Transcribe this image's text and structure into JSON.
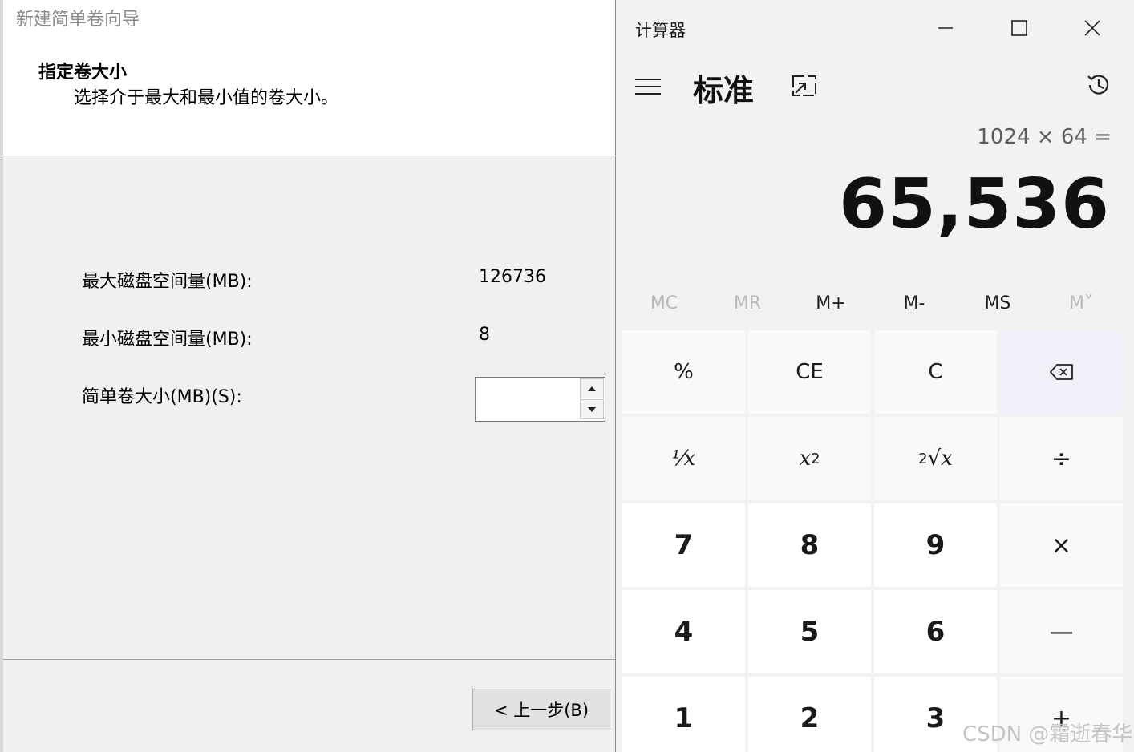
{
  "wizard": {
    "title": "新建简单卷向导",
    "heading": "指定卷大小",
    "subheading": "选择介于最大和最小值的卷大小。",
    "max_label": "最大磁盘空间量(MB):",
    "max_value": "126736",
    "min_label": "最小磁盘空间量(MB):",
    "min_value": "8",
    "size_label": "简单卷大小(MB)(S):",
    "size_value": "",
    "back_button": "< 上一步(B)"
  },
  "calculator": {
    "title": "计算器",
    "mode": "标准",
    "expression": "1024 × 64 =",
    "result": "65,536",
    "memory": [
      "MC",
      "MR",
      "M+",
      "M-",
      "MS",
      "M˅"
    ],
    "keys": {
      "percent": "%",
      "ce": "CE",
      "c": "C",
      "reciprocal": "⅟x",
      "square": "x",
      "square_sup": "2",
      "sqrt": "√x",
      "sqrt_sup": "2",
      "divide": "÷",
      "seven": "7",
      "eight": "8",
      "nine": "9",
      "multiply": "×",
      "four": "4",
      "five": "5",
      "six": "6",
      "minus": "—",
      "one": "1",
      "two": "2",
      "three": "3",
      "plus": "+"
    },
    "icons": [
      "minimize-icon",
      "maximize-icon",
      "close-icon",
      "hamburger-icon",
      "keep-on-top-icon",
      "history-icon",
      "backspace-icon"
    ]
  },
  "watermark": "CSDN @霜逝春华"
}
